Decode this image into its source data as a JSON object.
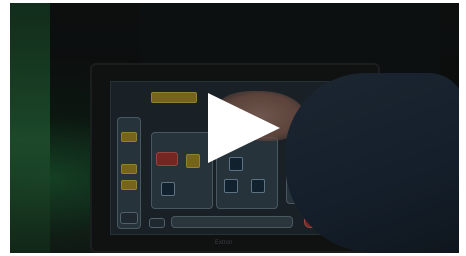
{
  "video": {
    "brand": "Extron",
    "play_icon": "play-icon",
    "colors": {
      "accent_yellow": "#b79a2a",
      "screen_blue": "#27343c",
      "play_white": "#ffffff"
    }
  }
}
